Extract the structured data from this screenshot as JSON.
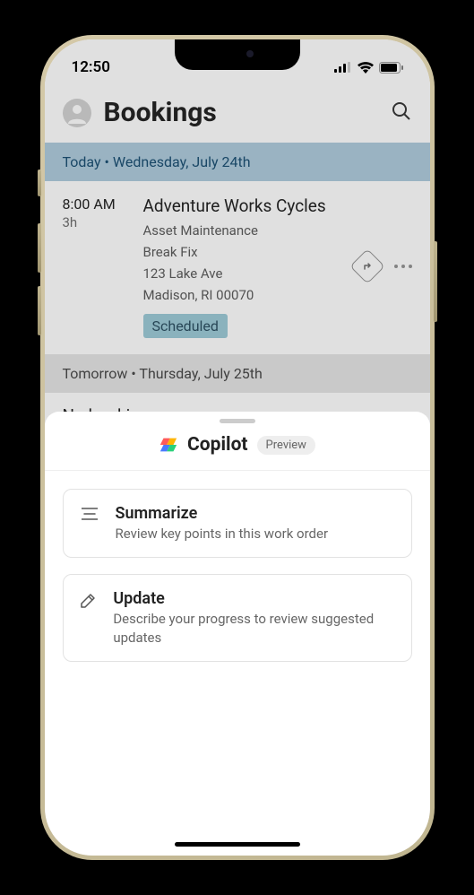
{
  "status_bar": {
    "time": "12:50"
  },
  "header": {
    "title": "Bookings"
  },
  "sections": {
    "today": {
      "label": "Today • Wednesday, July 24th"
    },
    "tomorrow": {
      "label": "Tomorrow • Thursday, July 25th"
    },
    "no_bookings": "No bookings"
  },
  "booking": {
    "time": "8:00 AM",
    "duration": "3h",
    "title": "Adventure Works Cycles",
    "category": "Asset Maintenance",
    "subtype": "Break Fix",
    "address1": "123 Lake Ave",
    "address2": "Madison, RI 00070",
    "status": "Scheduled"
  },
  "sheet": {
    "title": "Copilot",
    "badge": "Preview",
    "actions": [
      {
        "title": "Summarize",
        "desc": "Review key points in this work order"
      },
      {
        "title": "Update",
        "desc": "Describe your progress to review suggested updates"
      }
    ]
  }
}
